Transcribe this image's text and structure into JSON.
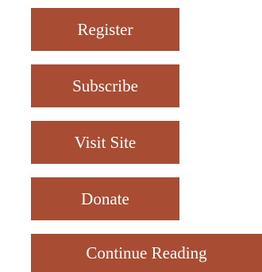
{
  "buttons": {
    "register": "Register",
    "subscribe": "Subscribe",
    "visit_site": "Visit Site",
    "donate": "Donate",
    "continue_reading": "Continue Reading"
  },
  "colors": {
    "button_background": "#a84d33",
    "button_text": "#ffffff",
    "page_background": "#ffffff"
  }
}
